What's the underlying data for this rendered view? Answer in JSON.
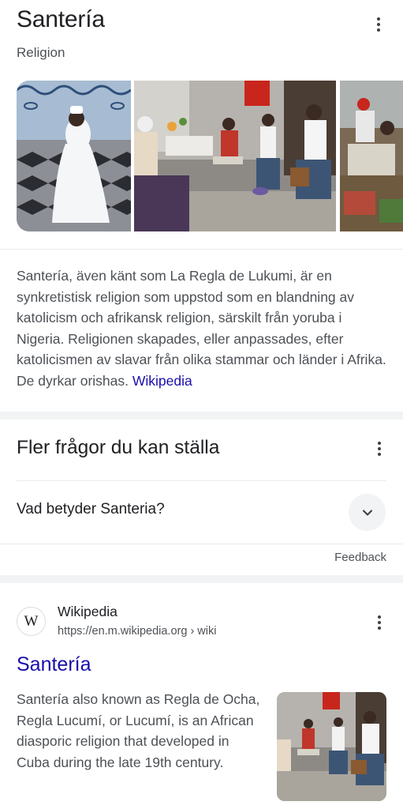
{
  "knowledge_panel": {
    "title": "Santería",
    "subtitle": "Religion",
    "description": "Santería, även känt som La Regla de Lukumi, är en synkretistisk religion som uppstod som en blandning av katolicism och afrikansk religion, särskilt från yoruba i Nigeria. Religionen skapades, eller anpassades, efter katolicismen av slavar från olika stammar och länder i Afrika. De dyrkar orishas.",
    "source_link": "Wikipedia"
  },
  "more_questions": {
    "title": "Fler frågor du kan ställa",
    "items": [
      {
        "question": "Vad betyder Santeria?"
      }
    ],
    "feedback": "Feedback"
  },
  "result": {
    "favicon_letter": "W",
    "site_name": "Wikipedia",
    "url": "https://en.m.wikipedia.org › wiki",
    "title": "Santería",
    "snippet": "Santería also known as Regla de Ocha, Regla Lucumí, or Lucumí, is an African diasporic religion that developed in Cuba during the late 19th century."
  },
  "icons": [
    "more-vert-icon",
    "chevron-down-icon",
    "wikipedia-icon"
  ],
  "colors": {
    "link": "#1a0dab",
    "text": "#202124",
    "secondary": "#4d5156",
    "divider": "#e8eaed"
  }
}
